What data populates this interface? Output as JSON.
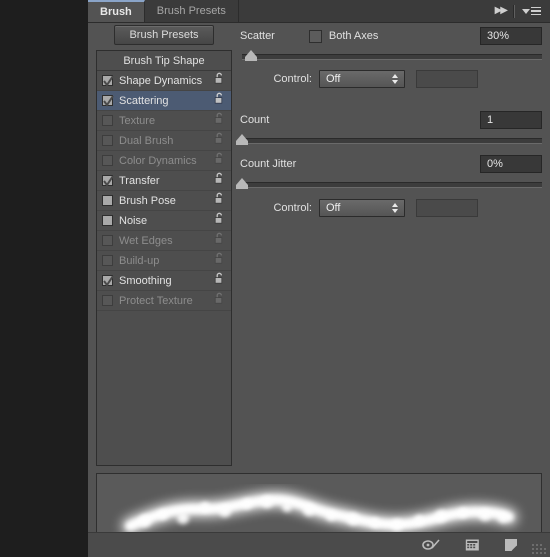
{
  "window": {
    "background_color": "#1e1e1e",
    "panel_color": "#535353"
  },
  "tabs": [
    {
      "label": "Brush",
      "active": true
    },
    {
      "label": "Brush Presets",
      "active": false
    }
  ],
  "header_icons": {
    "collapse": "double-arrow-right-icon",
    "menu": "panel-menu-icon"
  },
  "presets_button": {
    "label": "Brush Presets"
  },
  "brush_list": {
    "header": "Brush Tip Shape",
    "items": [
      {
        "label": "Shape Dynamics",
        "checked": true,
        "enabled": true,
        "selected": false,
        "locked": false
      },
      {
        "label": "Scattering",
        "checked": true,
        "enabled": true,
        "selected": true,
        "locked": false
      },
      {
        "label": "Texture",
        "checked": false,
        "enabled": false,
        "selected": false,
        "locked": false
      },
      {
        "label": "Dual Brush",
        "checked": false,
        "enabled": false,
        "selected": false,
        "locked": false
      },
      {
        "label": "Color Dynamics",
        "checked": false,
        "enabled": false,
        "selected": false,
        "locked": false
      },
      {
        "label": "Transfer",
        "checked": true,
        "enabled": true,
        "selected": false,
        "locked": false
      },
      {
        "label": "Brush Pose",
        "checked": false,
        "enabled": true,
        "selected": false,
        "locked": false
      },
      {
        "label": "Noise",
        "checked": false,
        "enabled": true,
        "selected": false,
        "locked": false
      },
      {
        "label": "Wet Edges",
        "checked": false,
        "enabled": false,
        "selected": false,
        "locked": false
      },
      {
        "label": "Build-up",
        "checked": false,
        "enabled": false,
        "selected": false,
        "locked": false
      },
      {
        "label": "Smoothing",
        "checked": true,
        "enabled": true,
        "selected": false,
        "locked": false
      },
      {
        "label": "Protect Texture",
        "checked": false,
        "enabled": false,
        "selected": false,
        "locked": false
      }
    ]
  },
  "scattering": {
    "scatter": {
      "label": "Scatter",
      "both_axes_label": "Both Axes",
      "both_axes_checked": false,
      "value": "30%",
      "slider_percent": 3
    },
    "scatter_control": {
      "label": "Control:",
      "value": "Off"
    },
    "count": {
      "label": "Count",
      "value": "1",
      "slider_percent": 0
    },
    "count_jitter": {
      "label": "Count Jitter",
      "value": "0%",
      "slider_percent": 0
    },
    "count_jitter_control": {
      "label": "Control:",
      "value": "Off"
    }
  },
  "preview": {
    "name": "brush-stroke-preview"
  },
  "footer_icons": [
    {
      "name": "toggle-brush-settings-icon"
    },
    {
      "name": "brush-presets-panel-icon"
    },
    {
      "name": "new-brush-preset-icon"
    }
  ]
}
